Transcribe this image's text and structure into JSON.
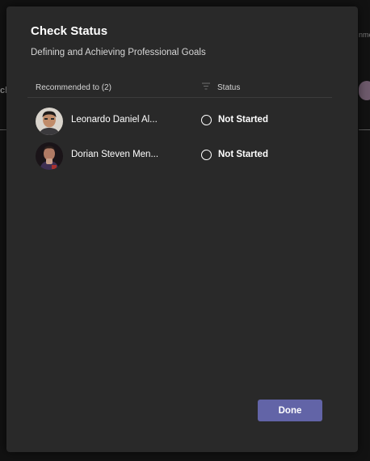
{
  "dialog": {
    "title": "Check Status",
    "subtitle": "Defining and Achieving Professional Goals",
    "header": {
      "recommended_label": "Recommended to (2)",
      "status_label": "Status"
    },
    "rows": [
      {
        "name": "Leonardo Daniel Al...",
        "status": "Not Started"
      },
      {
        "name": "Dorian Steven Men...",
        "status": "Not Started"
      }
    ],
    "done_label": "Done"
  },
  "background": {
    "left_fragment": "cl",
    "right_fragment": "nme"
  },
  "colors": {
    "dialog_bg": "#292929",
    "accent": "#6264a7",
    "text": "#ffffff"
  },
  "icons": {
    "filter": "filter-icon",
    "status": "status-circle-icon"
  }
}
